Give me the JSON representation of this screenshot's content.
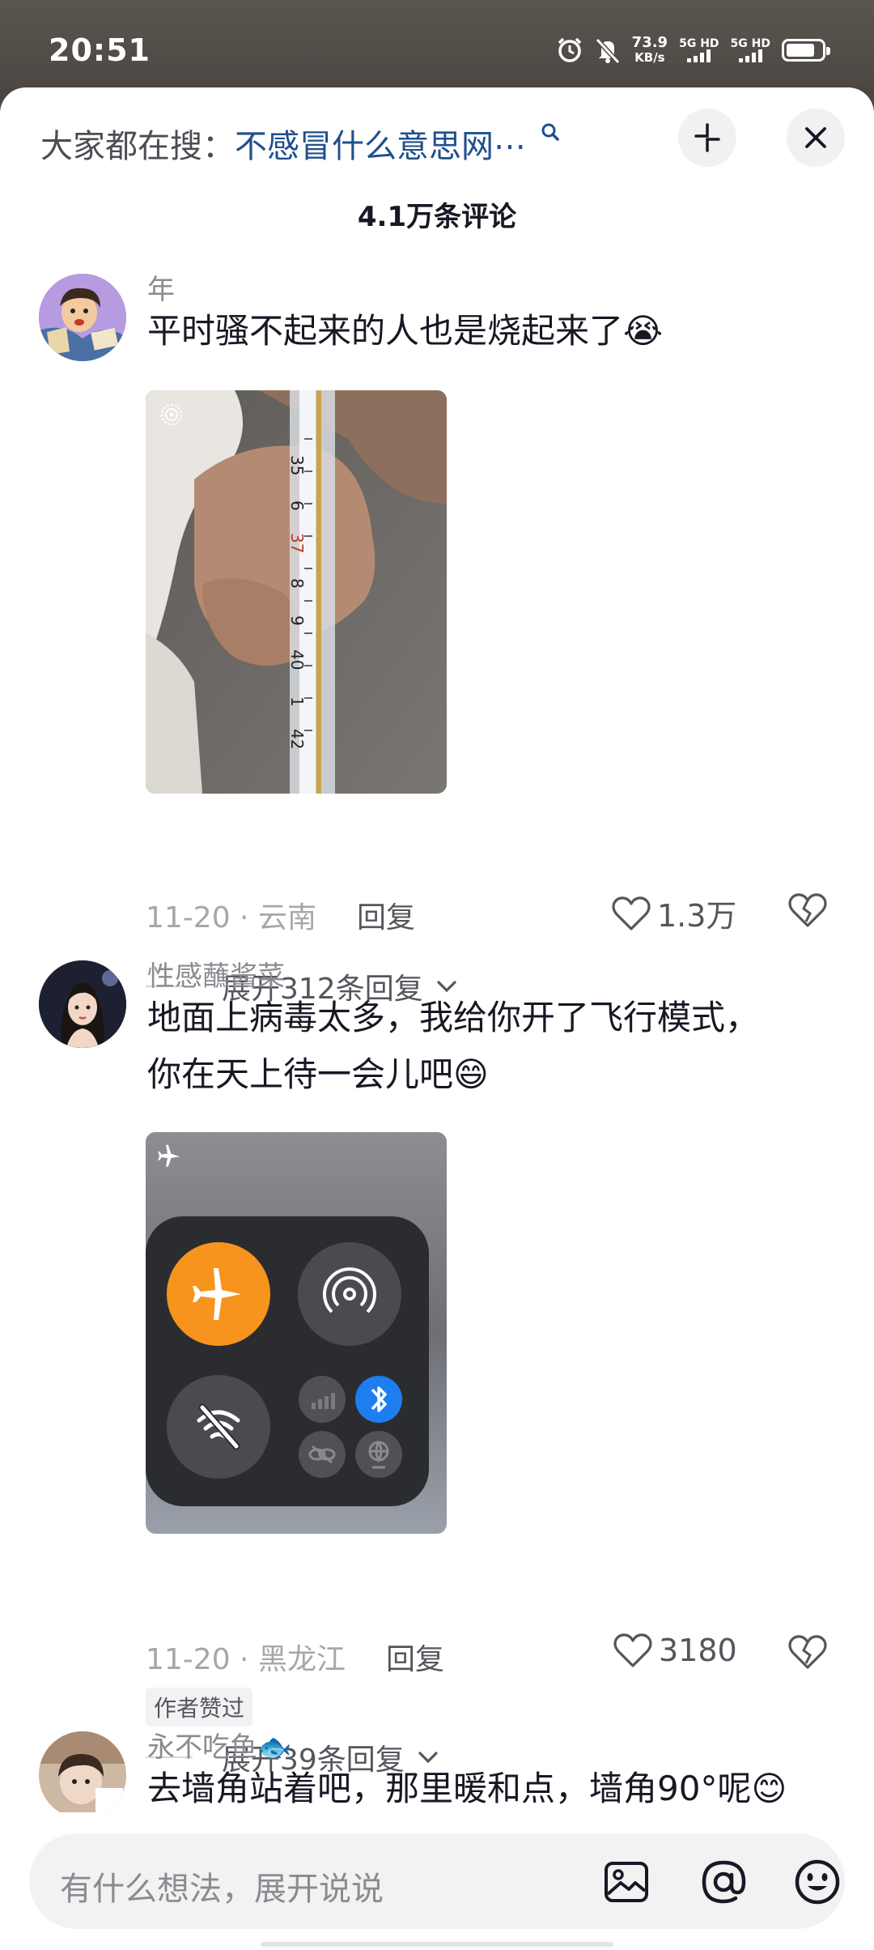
{
  "status_bar": {
    "time": "20:51",
    "net_speed_value": "73.9",
    "net_speed_unit": "KB/s",
    "sim1": "5G HD",
    "sim2": "5G HD",
    "icons": [
      "alarm-icon",
      "mute-icon",
      "battery-icon"
    ]
  },
  "header": {
    "search_prefix": "大家都在搜：",
    "search_term": "不感冒什么意思网⋯",
    "icons": [
      "search-icon",
      "collapse-icon",
      "close-icon"
    ],
    "comment_count": "4.1万条评论"
  },
  "comments": [
    {
      "username": "年",
      "text": "平时骚不起来的人也是烧起来了",
      "emoji": "😭",
      "date_location": "11-20 · 云南",
      "reply_label": "回复",
      "likes": "1.3万",
      "expand_label": "展开312条回复",
      "image": {
        "type": "photo-thermometer",
        "scale_labels": [
          "35",
          "6",
          "37",
          "8",
          "9",
          "40",
          "1",
          "42"
        ]
      }
    },
    {
      "username": "性感蘸酱菜",
      "text_line1": "地面上病毒太多，我给你开了飞行模式，",
      "text_line2": "你在天上待一会儿吧",
      "emoji": "😄",
      "date_location": "11-20 · 黑龙江",
      "reply_label": "回复",
      "likes": "3180",
      "badge": "作者赞过",
      "expand_label": "展开39条回复",
      "image": {
        "type": "screenshot-control-center",
        "airplane_color": "#f7941d",
        "bluetooth_color": "#1e7ef0"
      }
    },
    {
      "username": "永不吃鱼",
      "username_emoji": "🐟",
      "text_partial": "去墙角站着吧，那里暖和点，墙角90°呢",
      "emoji": "😊"
    }
  ],
  "composer": {
    "placeholder": "有什么想法，展开说说",
    "icons": [
      "image-icon",
      "at-icon",
      "emoji-icon"
    ]
  },
  "colors": {
    "search_term": "#1f4f8c",
    "username": "#8a8b91",
    "meta": "#a6a7ab",
    "text": "#161823"
  }
}
